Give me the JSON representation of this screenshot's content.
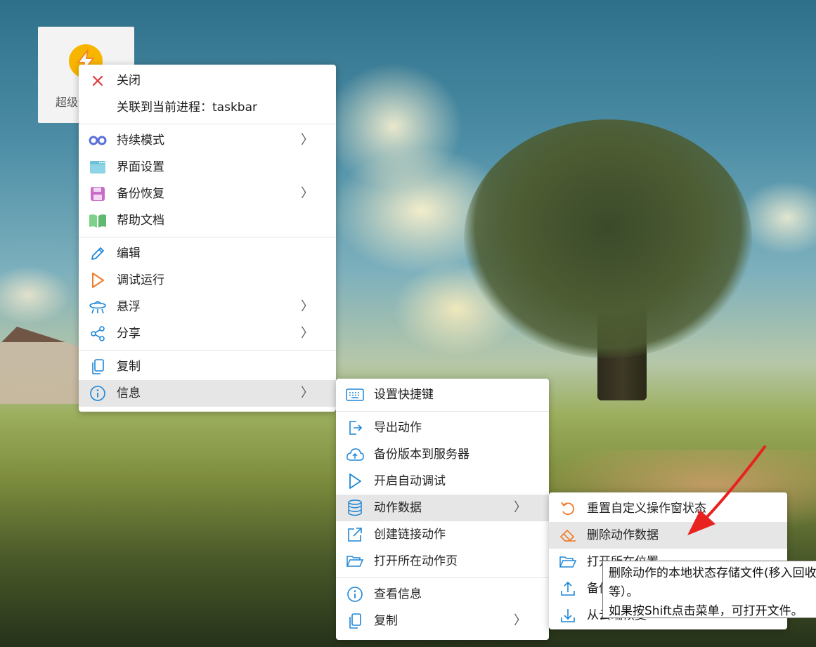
{
  "app_tile": {
    "label": "超级",
    "icon": "lightning-bolt-icon",
    "accent": "#f7b500"
  },
  "main_menu": {
    "groups": [
      [
        {
          "label": "关闭",
          "icon": "close-icon",
          "submenu": false
        },
        {
          "label": "关联到当前进程：taskbar",
          "icon": "",
          "submenu": false
        }
      ],
      [
        {
          "label": "持续模式",
          "icon": "infinity-icon",
          "submenu": true
        },
        {
          "label": "界面设置",
          "icon": "window-icon",
          "submenu": false
        },
        {
          "label": "备份恢复",
          "icon": "floppy-disk-icon",
          "submenu": true
        },
        {
          "label": "帮助文档",
          "icon": "book-icon",
          "submenu": false
        }
      ],
      [
        {
          "label": "编辑",
          "icon": "pencil-icon",
          "submenu": false
        },
        {
          "label": "调试运行",
          "icon": "play-icon",
          "submenu": false
        },
        {
          "label": "悬浮",
          "icon": "ufo-icon",
          "submenu": true
        },
        {
          "label": "分享",
          "icon": "share-icon",
          "submenu": true
        }
      ],
      [
        {
          "label": "复制",
          "icon": "copy-icon",
          "submenu": false
        },
        {
          "label": "信息",
          "icon": "info-icon",
          "submenu": true,
          "highlighted": true
        }
      ]
    ]
  },
  "info_menu": {
    "groups": [
      [
        {
          "label": "设置快捷键",
          "icon": "keyboard-icon",
          "submenu": false
        }
      ],
      [
        {
          "label": "导出动作",
          "icon": "export-icon",
          "submenu": false
        },
        {
          "label": "备份版本到服务器",
          "icon": "cloud-upload-icon",
          "submenu": false
        },
        {
          "label": "开启自动调试",
          "icon": "play-icon",
          "submenu": false
        },
        {
          "label": "动作数据",
          "icon": "database-icon",
          "submenu": true,
          "highlighted": true
        },
        {
          "label": "创建链接动作",
          "icon": "external-link-icon",
          "submenu": false
        },
        {
          "label": "打开所在动作页",
          "icon": "folder-open-icon",
          "submenu": false
        }
      ],
      [
        {
          "label": "查看信息",
          "icon": "info-icon",
          "submenu": false
        },
        {
          "label": "复制",
          "icon": "copy-icon",
          "submenu": true
        }
      ]
    ]
  },
  "data_menu": {
    "items": [
      {
        "label": "重置自定义操作窗状态",
        "icon": "undo-icon"
      },
      {
        "label": "删除动作数据",
        "icon": "eraser-icon",
        "highlighted": true
      },
      {
        "label": "打开所在位置",
        "icon": "folder-open-icon"
      },
      {
        "label": "备份",
        "icon": "upload-tray-icon"
      },
      {
        "label": "从云端恢复",
        "icon": "download-tray-icon"
      }
    ]
  },
  "tooltip": {
    "line1": "删除动作的本地状态存储文件(移入回收站",
    "line2": "等）。",
    "line3": "如果按Shift点击菜单，可打开文件。"
  },
  "colors": {
    "annotation_arrow": "#e8231f",
    "menu_highlight": "#e6e6e6",
    "icon_blue": "#1e86d6"
  }
}
